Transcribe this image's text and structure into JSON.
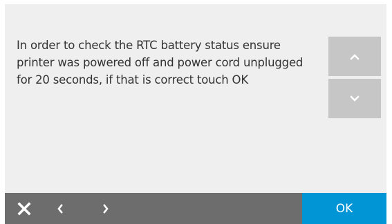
{
  "dialog": {
    "message": "In order to check the RTC battery status ensure printer was powered off and power cord unplugged for 20 seconds, if that is correct touch OK"
  },
  "scroll": {
    "up_icon": "chevron-up-icon",
    "down_icon": "chevron-down-icon"
  },
  "bottom_bar": {
    "close_icon": "close-icon",
    "back_icon": "chevron-left-icon",
    "forward_icon": "chevron-right-icon",
    "ok_label": "OK"
  },
  "colors": {
    "background": "#efefef",
    "scroll_button": "#c6c6c6",
    "bottom_bar": "#6d6d6d",
    "ok_button": "#0195d6",
    "text": "#333333"
  }
}
